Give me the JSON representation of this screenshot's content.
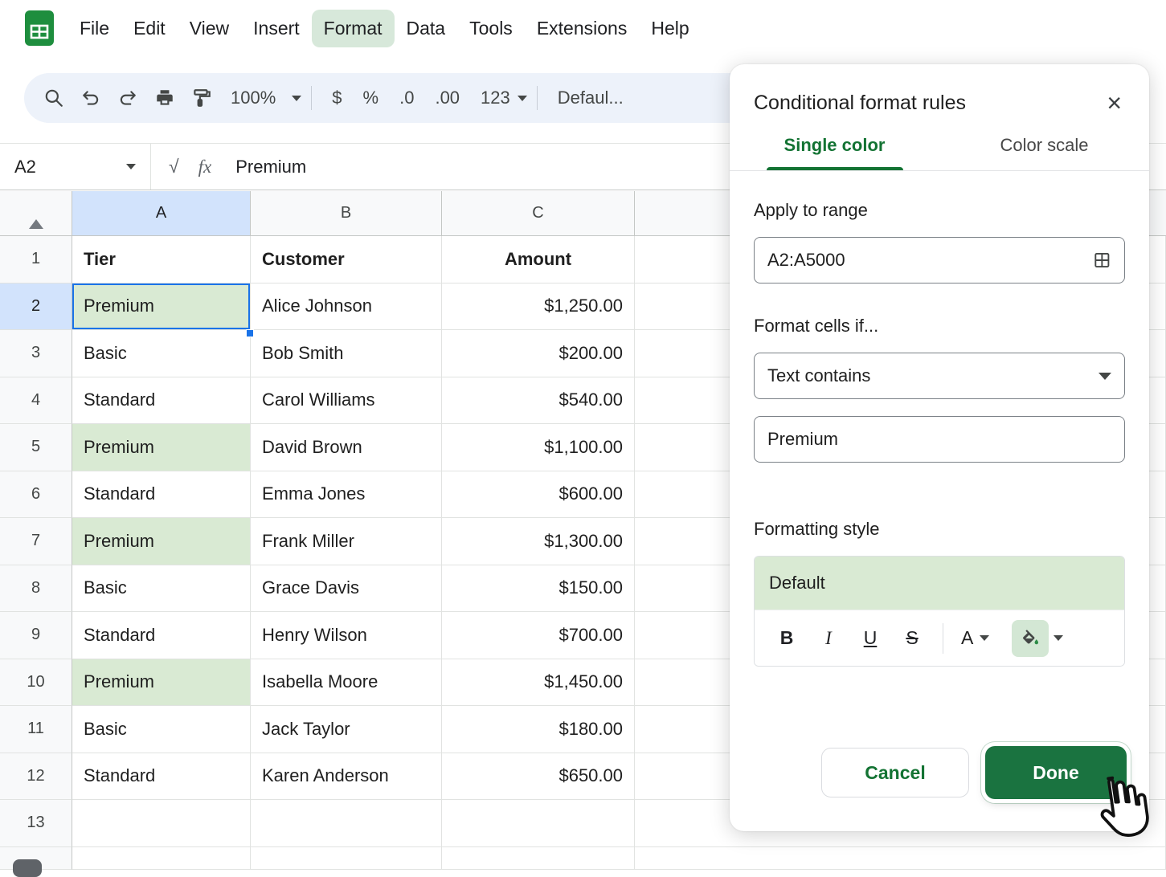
{
  "menu": {
    "items": [
      "File",
      "Edit",
      "View",
      "Insert",
      "Format",
      "Data",
      "Tools",
      "Extensions",
      "Help"
    ]
  },
  "toolbar": {
    "zoom": "100%",
    "currency": "$",
    "percent": "%",
    "decimal_decrease": ".0",
    "decimal_increase": ".00",
    "number_format": "123",
    "font_name": "Defaul..."
  },
  "formula_bar": {
    "cell_ref": "A2",
    "radical": "√",
    "fx": "fx",
    "value": "Premium"
  },
  "grid": {
    "col_headers": [
      "A",
      "B",
      "C"
    ],
    "rows": [
      {
        "n": "1",
        "tier": "Tier",
        "customer": "Customer",
        "amount": "Amount"
      },
      {
        "n": "2",
        "tier": "Premium",
        "customer": "Alice Johnson",
        "amount": "$1,250.00"
      },
      {
        "n": "3",
        "tier": "Basic",
        "customer": "Bob Smith",
        "amount": "$200.00"
      },
      {
        "n": "4",
        "tier": "Standard",
        "customer": "Carol Williams",
        "amount": "$540.00"
      },
      {
        "n": "5",
        "tier": "Premium",
        "customer": "David Brown",
        "amount": "$1,100.00"
      },
      {
        "n": "6",
        "tier": "Standard",
        "customer": "Emma Jones",
        "amount": "$600.00"
      },
      {
        "n": "7",
        "tier": "Premium",
        "customer": "Frank Miller",
        "amount": "$1,300.00"
      },
      {
        "n": "8",
        "tier": "Basic",
        "customer": "Grace Davis",
        "amount": "$150.00"
      },
      {
        "n": "9",
        "tier": "Standard",
        "customer": "Henry Wilson",
        "amount": "$700.00"
      },
      {
        "n": "10",
        "tier": "Premium",
        "customer": "Isabella Moore",
        "amount": "$1,450.00"
      },
      {
        "n": "11",
        "tier": "Basic",
        "customer": "Jack Taylor",
        "amount": "$180.00"
      },
      {
        "n": "12",
        "tier": "Standard",
        "customer": "Karen Anderson",
        "amount": "$650.00"
      },
      {
        "n": "13",
        "tier": "",
        "customer": "",
        "amount": ""
      }
    ]
  },
  "panel": {
    "title": "Conditional format rules",
    "close": "×",
    "tabs": {
      "single_color": "Single color",
      "color_scale": "Color scale"
    },
    "apply_to_range_label": "Apply to range",
    "range_value": "A2:A5000",
    "format_cells_if_label": "Format cells if...",
    "condition": "Text contains",
    "condition_value": "Premium",
    "formatting_style_label": "Formatting style",
    "style_preview": "Default",
    "format_buttons": {
      "bold": "B",
      "italic": "I",
      "underline": "U",
      "strikethrough": "S",
      "text_color": "A"
    },
    "cancel": "Cancel",
    "done": "Done"
  },
  "colors": {
    "accent_green": "#188038",
    "highlight_green": "#d9ead3",
    "selection_blue": "#1a73e8"
  }
}
